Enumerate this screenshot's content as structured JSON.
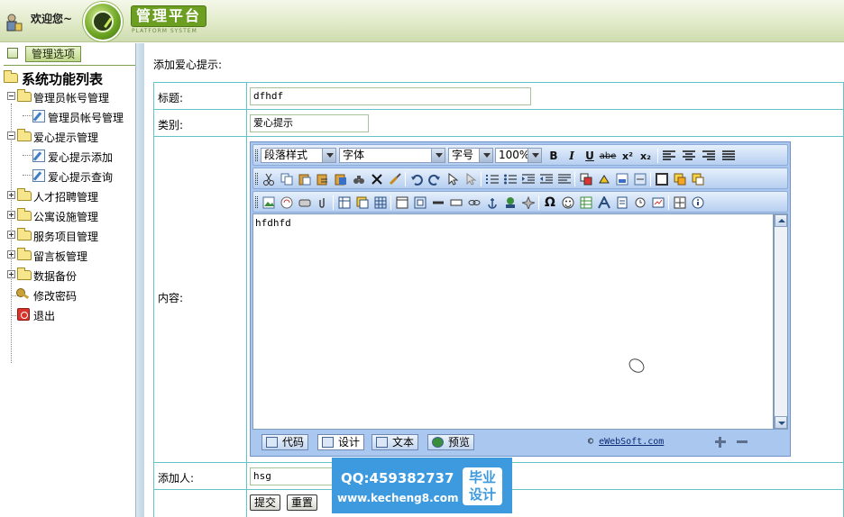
{
  "header": {
    "welcome": "欢迎您~",
    "logo_title": "管理平台",
    "logo_subtitle": "PLATFORM SYSTEM"
  },
  "sidebar": {
    "header_button": "管理选项",
    "root_label": "系统功能列表",
    "groups": [
      {
        "label": "管理员帐号管理",
        "children": [
          "管理员帐号管理"
        ]
      },
      {
        "label": "爱心提示管理",
        "children": [
          "爱心提示添加",
          "爱心提示查询"
        ]
      },
      {
        "label": "人才招聘管理"
      },
      {
        "label": "公寓设施管理"
      },
      {
        "label": "服务项目管理"
      },
      {
        "label": "留言板管理"
      },
      {
        "label": "数据备份"
      }
    ],
    "change_password": "修改密码",
    "logout": "退出"
  },
  "main": {
    "page_heading": "添加爱心提示:",
    "fields": {
      "title_label": "标题:",
      "title_value": "dfhdf",
      "category_label": "类别:",
      "category_value": "爱心提示",
      "content_label": "内容:",
      "adder_label": "添加人:",
      "adder_value": "hsg"
    },
    "submit_label": "提交",
    "reset_label": "重置"
  },
  "editor": {
    "paragraph_style": "段落样式",
    "font": "字体",
    "font_size": "字号",
    "zoom": "100%",
    "bold": "B",
    "italic": "I",
    "underline": "U",
    "strike": "abe",
    "superscript": "x²",
    "subscript": "x₂",
    "omega": "Ω",
    "content": "hfdhfd",
    "modes": [
      "代码",
      "设计",
      "文本",
      "预览"
    ],
    "copyright_symbol": "©",
    "copyright_link": "eWebSoft.com"
  },
  "watermark": {
    "qq": "QQ:459382737",
    "url": "www.kecheng8.com",
    "badge_line1": "毕业",
    "badge_line2": "设计"
  }
}
